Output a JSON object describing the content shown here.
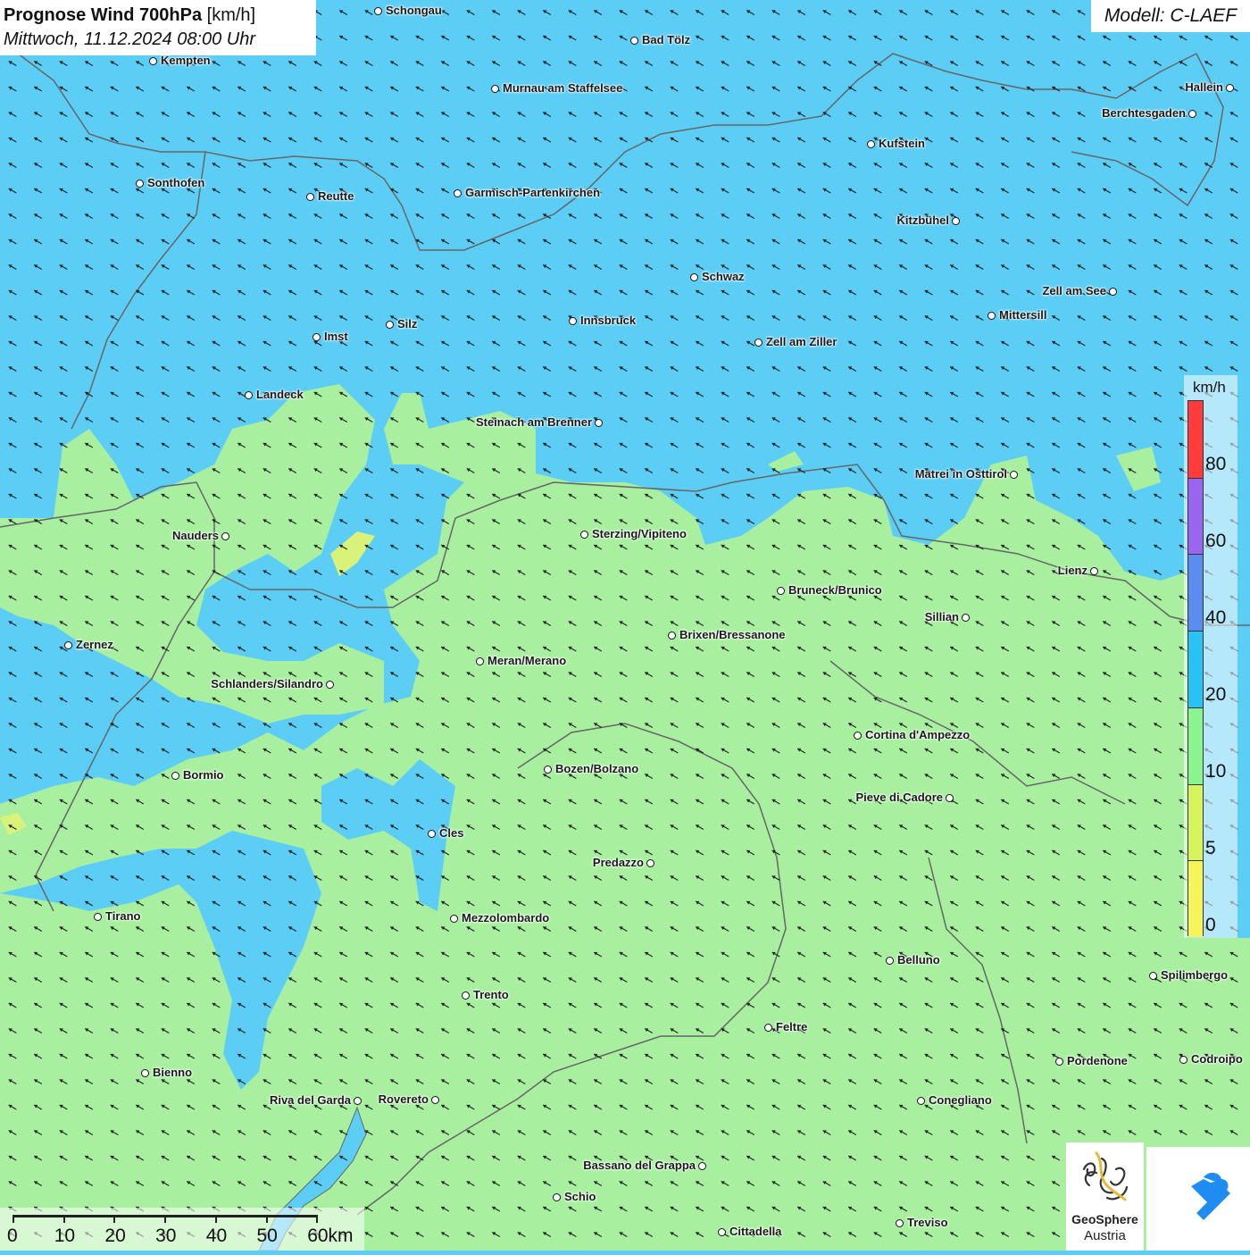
{
  "title": {
    "main": "Prognose Wind 700hPa",
    "unit": "[km/h]",
    "date": "Mittwoch, 11.12.2024 08:00 Uhr"
  },
  "model": "Modell: C-LAEF",
  "legend": {
    "unit": "km/h",
    "labels": [
      "80",
      "60",
      "40",
      "20",
      "10",
      "5",
      "0"
    ],
    "colors": [
      "#ff3b3b",
      "#9a66f0",
      "#5b8cf0",
      "#28c2f5",
      "#8af58f",
      "#d5f55a",
      "#f5f55a"
    ]
  },
  "scalebar": {
    "labels": [
      "0",
      "10",
      "20",
      "30",
      "40",
      "50",
      "60km"
    ]
  },
  "map_colors": {
    "wind_20_40": "#5ccdf5",
    "wind_10_20": "#a8f0a0",
    "wind_5_10": "#d9f27a",
    "arrow": "#222222",
    "border": "#666666"
  },
  "cities": [
    {
      "name": "Schongau"
    },
    {
      "name": "Bad Tölz"
    },
    {
      "name": "Kempten"
    },
    {
      "name": "Murnau am Staffelsee"
    },
    {
      "name": "Hallein"
    },
    {
      "name": "Berchtesgaden"
    },
    {
      "name": "Kufstein"
    },
    {
      "name": "Sonthofen"
    },
    {
      "name": "Reutte"
    },
    {
      "name": "Garmisch-Partenkirchen"
    },
    {
      "name": "Kitzbühel"
    },
    {
      "name": "Schwaz"
    },
    {
      "name": "Zell am See"
    },
    {
      "name": "Mittersill"
    },
    {
      "name": "Imst"
    },
    {
      "name": "Silz"
    },
    {
      "name": "Innsbruck"
    },
    {
      "name": "Zell am Ziller"
    },
    {
      "name": "Landeck"
    },
    {
      "name": "Steinach am Brenner"
    },
    {
      "name": "Matrei in Osttirol"
    },
    {
      "name": "Nauders"
    },
    {
      "name": "Sterzing/Vipiteno"
    },
    {
      "name": "Lienz"
    },
    {
      "name": "Bruneck/Brunico"
    },
    {
      "name": "Sillian"
    },
    {
      "name": "Zernez"
    },
    {
      "name": "Brixen/Bressanone"
    },
    {
      "name": "Meran/Merano"
    },
    {
      "name": "Schlanders/Silandro"
    },
    {
      "name": "Cortina d'Ampezzo"
    },
    {
      "name": "Bozen/Bolzano"
    },
    {
      "name": "Bormio"
    },
    {
      "name": "Pieve di Cadore"
    },
    {
      "name": "Cles"
    },
    {
      "name": "Predazzo"
    },
    {
      "name": "Tirano"
    },
    {
      "name": "Mezzolombardo"
    },
    {
      "name": "Belluno"
    },
    {
      "name": "Spilimbergo"
    },
    {
      "name": "Trento"
    },
    {
      "name": "Feltre"
    },
    {
      "name": "Pordenone"
    },
    {
      "name": "Codroipo"
    },
    {
      "name": "Bienno"
    },
    {
      "name": "Riva del Garda"
    },
    {
      "name": "Rovereto"
    },
    {
      "name": "Conegliano"
    },
    {
      "name": "Bassano del Grappa"
    },
    {
      "name": "Schio"
    },
    {
      "name": "Treviso"
    },
    {
      "name": "Cittadella"
    }
  ],
  "logo": {
    "text1": "GeoSphere",
    "text2": "Austria"
  }
}
